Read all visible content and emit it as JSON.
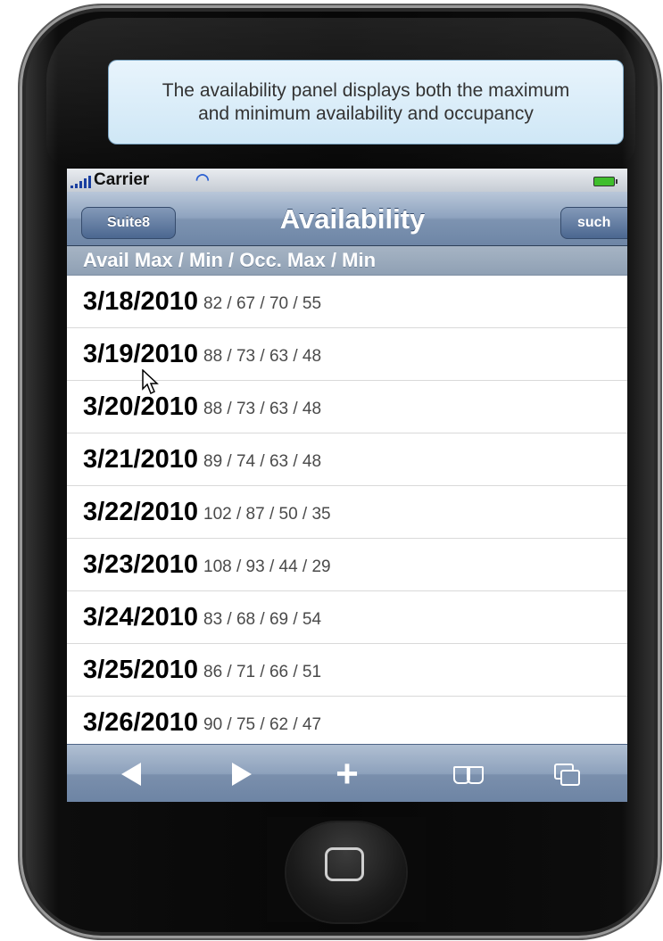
{
  "callout": {
    "text": "The availability panel displays both the maximum and minimum availability  and occupancy"
  },
  "statusbar": {
    "carrier": "Carrier"
  },
  "navbar": {
    "back_label": "Suite8",
    "title": "Availability",
    "right_label": "such"
  },
  "section_header": "Avail Max / Min / Occ. Max / Min",
  "rows": [
    {
      "date": "3/18/2010",
      "values": "82 / 67 / 70 / 55"
    },
    {
      "date": "3/19/2010",
      "values": "88 / 73 / 63 / 48"
    },
    {
      "date": "3/20/2010",
      "values": "88 / 73 / 63 / 48"
    },
    {
      "date": "3/21/2010",
      "values": "89 / 74 / 63 / 48"
    },
    {
      "date": "3/22/2010",
      "values": "102 / 87 / 50 / 35"
    },
    {
      "date": "3/23/2010",
      "values": "108 / 93 / 44 / 29"
    },
    {
      "date": "3/24/2010",
      "values": "83 / 68 / 69 / 54"
    },
    {
      "date": "3/25/2010",
      "values": "86 / 71 / 66 / 51"
    },
    {
      "date": "3/26/2010",
      "values": "90 / 75 / 62 / 47"
    }
  ],
  "toolbar": {
    "icons": [
      "back-arrow-icon",
      "forward-arrow-icon",
      "plus-icon",
      "bookmarks-icon",
      "pages-icon"
    ]
  },
  "colors": {
    "navbar": "#8ea3bf",
    "section_header": "#9aa9bb",
    "callout_bg": "#d8ecf8",
    "device_body": "#0a0a0a"
  }
}
